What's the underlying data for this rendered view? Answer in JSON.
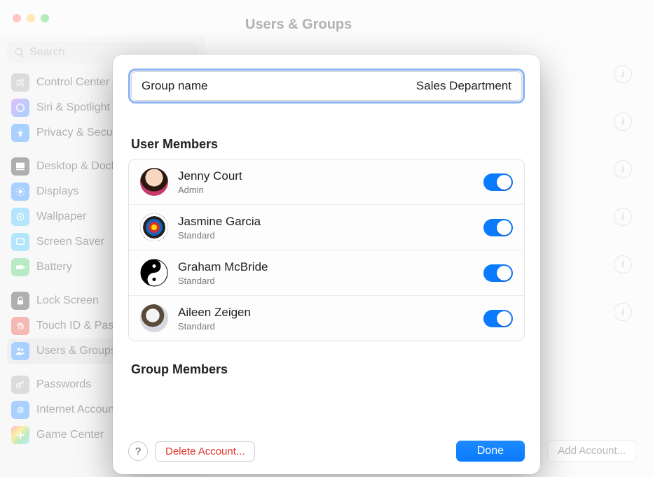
{
  "window": {
    "title": "Users & Groups"
  },
  "search": {
    "placeholder": "Search"
  },
  "sidebar": {
    "items": [
      {
        "label": "Control Center",
        "icon": "control-center",
        "bg": "#9a9aa0"
      },
      {
        "label": "Siri & Spotlight",
        "icon": "siri",
        "bg": "linear-gradient(135deg,#a64cf0,#0a7aff)"
      },
      {
        "label": "Privacy & Security",
        "icon": "privacy",
        "bg": "#0a7aff"
      },
      {
        "label": "Desktop & Dock",
        "icon": "desktop",
        "bg": "#1c1c1e"
      },
      {
        "label": "Displays",
        "icon": "displays",
        "bg": "#0a7aff"
      },
      {
        "label": "Wallpaper",
        "icon": "wallpaper",
        "bg": "#28b6f6"
      },
      {
        "label": "Screen Saver",
        "icon": "screensaver",
        "bg": "#28b6f6"
      },
      {
        "label": "Battery",
        "icon": "battery",
        "bg": "#34c759"
      },
      {
        "label": "Lock Screen",
        "icon": "lock",
        "bg": "#1c1c1e"
      },
      {
        "label": "Touch ID & Password",
        "icon": "touchid",
        "bg": "#e0352b"
      },
      {
        "label": "Users & Groups",
        "icon": "users",
        "bg": "#0a7aff",
        "selected": true
      },
      {
        "label": "Passwords",
        "icon": "key",
        "bg": "#9a9aa0"
      },
      {
        "label": "Internet Accounts",
        "icon": "at",
        "bg": "#0a7aff"
      },
      {
        "label": "Game Center",
        "icon": "game",
        "bg": "linear-gradient(135deg,#ff2d55,#ffcc00,#34c759,#5ac8fa)"
      }
    ]
  },
  "main": {
    "info_rows": 6,
    "add_account_label": "Add Account..."
  },
  "sheet": {
    "group_name_label": "Group name",
    "group_name_value": "Sales Department",
    "user_members_heading": "User Members",
    "group_members_heading": "Group Members",
    "users": [
      {
        "name": "Jenny Court",
        "role": "Admin",
        "avatar": "jenny",
        "enabled": true
      },
      {
        "name": "Jasmine Garcia",
        "role": "Standard",
        "avatar": "target",
        "enabled": true
      },
      {
        "name": "Graham McBride",
        "role": "Standard",
        "avatar": "yinyang",
        "enabled": true
      },
      {
        "name": "Aileen Zeigen",
        "role": "Standard",
        "avatar": "eagle",
        "enabled": true
      }
    ],
    "help_label": "?",
    "delete_label": "Delete Account...",
    "done_label": "Done"
  }
}
